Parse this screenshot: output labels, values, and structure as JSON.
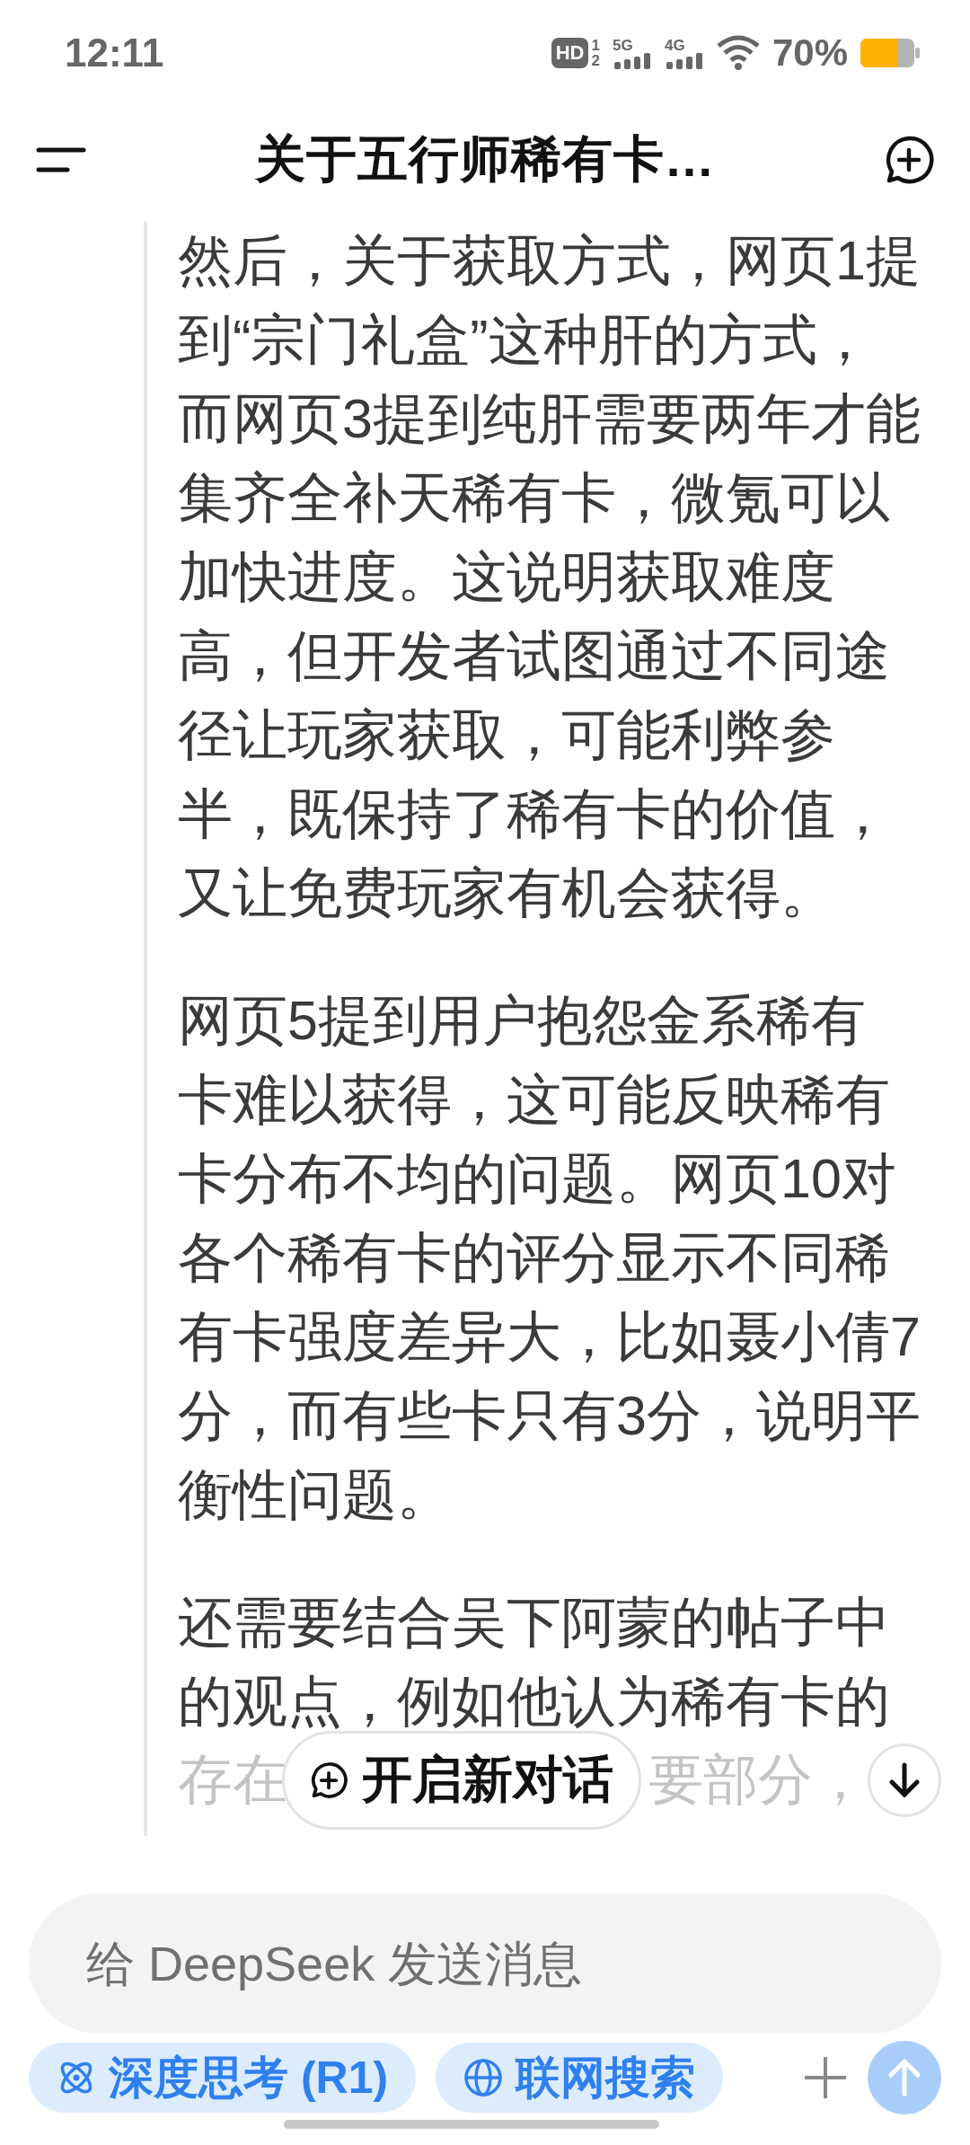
{
  "status_bar": {
    "time": "12:11",
    "hd": "HD",
    "sim_slots": [
      "1",
      "2"
    ],
    "signals": [
      {
        "label": "5G"
      },
      {
        "label": "4G"
      }
    ],
    "battery_text": "70%"
  },
  "header": {
    "title": "关于五行师稀有卡…"
  },
  "message": {
    "paragraphs": [
      {
        "lines": [
          "然后，关于获取方式，网页1提",
          "到“宗门礼盒”这种肝的方式，",
          "而网页3提到纯肝需要两年才能",
          "集齐全补天稀有卡，微氪可以",
          "加快进度。这说明获取难度",
          "高，但开发者试图通过不同途",
          "径让玩家获取，可能利弊参",
          "半，既保持了稀有卡的价值，",
          "又让免费玩家有机会获得。"
        ]
      },
      {
        "lines": [
          "网页5提到用户抱怨金系稀有",
          "卡难以获得，这可能反映稀有",
          "卡分布不均的问题。网页10对",
          "各个稀有卡的评分显示不同稀",
          "有卡强度差异大，比如聂小倩7",
          "分，而有些卡只有3分，说明平",
          "衡性问题。"
        ]
      },
      {
        "lines": [
          "还需要结合吴下阿蒙的帖子中",
          "的观点，例如他认为稀有卡的"
        ]
      }
    ],
    "faded_line_parts": [
      "存在",
      "要部分，"
    ]
  },
  "new_chat_button": {
    "label": "开启新对话"
  },
  "composer": {
    "placeholder": "给 DeepSeek 发送消息",
    "chips": [
      {
        "label": "深度思考 (R1)",
        "selected": true
      },
      {
        "label": "联网搜索",
        "selected": true
      }
    ],
    "send_disabled": true
  }
}
